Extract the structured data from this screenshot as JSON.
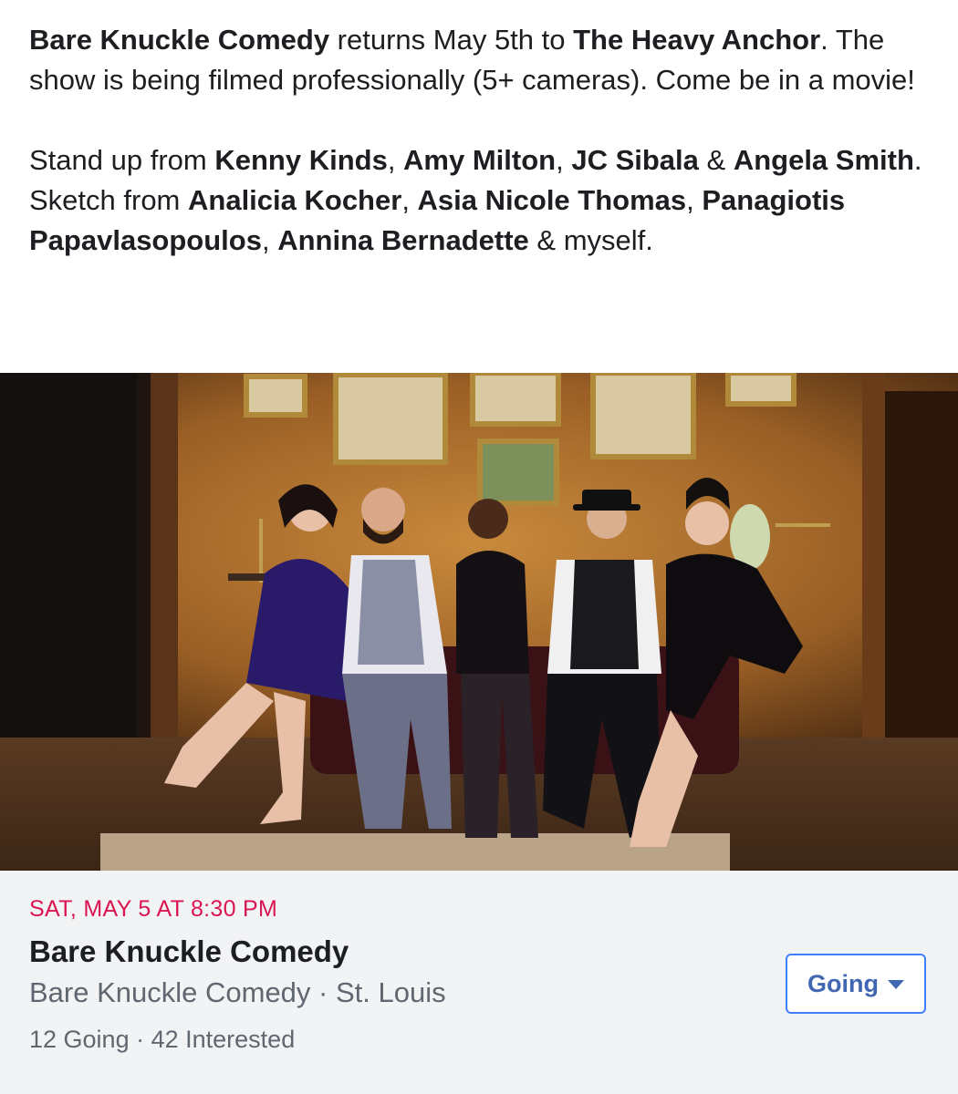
{
  "post": {
    "p1": {
      "org": "Bare Knuckle Comedy",
      "t1": " returns May 5th to ",
      "venue": "The Heavy Anchor",
      "t2": ".  The show is being filmed professionally (5+ cameras). Come be in a movie!"
    },
    "p2": {
      "t1": "Stand up from ",
      "n1": "Kenny Kinds",
      "s1": ", ",
      "n2": "Amy Milton",
      "s2": ", ",
      "n3": "JC Sibala",
      "s3": " & ",
      "n4": "Angela Smith",
      "t2": ".  Sketch from ",
      "n5": "Analicia Kocher",
      "s4": ", ",
      "n6": "Asia Nicole Thomas",
      "s5": ", ",
      "n7": "Panagiotis Papavlasopoulos",
      "s6": ", ",
      "n8": "Annina Bernadette",
      "t3": " & myself."
    }
  },
  "event": {
    "date": "SAT, MAY 5 AT 8:30 PM",
    "title": "Bare Knuckle Comedy",
    "host": "Bare Knuckle Comedy",
    "separator": " · ",
    "location": "St. Louis",
    "going_count": "12 Going",
    "interested_count": "42 Interested",
    "rsvp_label": "Going",
    "rsvp_icon": "caret-down-icon"
  },
  "colors": {
    "date_red": "#d9164f",
    "link_blue": "#4267b2",
    "card_bg": "#f2f3f5"
  }
}
